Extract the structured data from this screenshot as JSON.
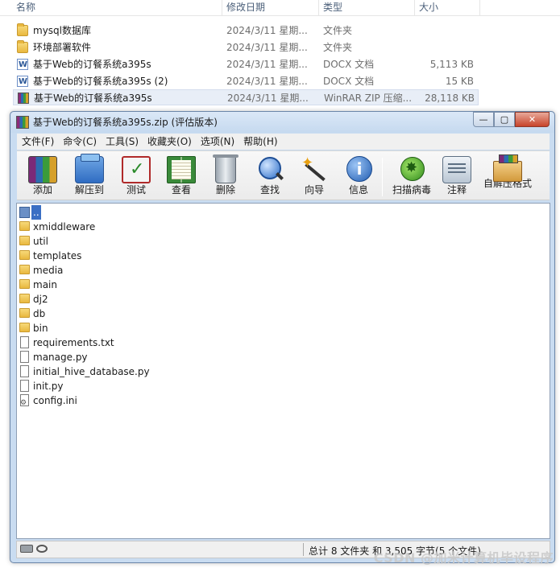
{
  "explorer": {
    "columns": {
      "name": "名称",
      "date": "修改日期",
      "type": "类型",
      "size": "大小"
    },
    "rows": [
      {
        "name": "mysql数据库",
        "date": "2024/3/11 星期...",
        "type": "文件夹",
        "size": "",
        "icon": "folder-icon"
      },
      {
        "name": "环境部署软件",
        "date": "2024/3/11 星期...",
        "type": "文件夹",
        "size": "",
        "icon": "folder-icon"
      },
      {
        "name": "基于Web的订餐系统a395s",
        "date": "2024/3/11 星期...",
        "type": "DOCX 文档",
        "size": "5,113 KB",
        "icon": "docx-icon"
      },
      {
        "name": "基于Web的订餐系统a395s (2)",
        "date": "2024/3/11 星期...",
        "type": "DOCX 文档",
        "size": "15 KB",
        "icon": "docx-icon"
      },
      {
        "name": "基于Web的订餐系统a395s",
        "date": "2024/3/11 星期...",
        "type": "WinRAR ZIP 压缩...",
        "size": "28,118 KB",
        "icon": "winrar-archive-icon"
      }
    ]
  },
  "window": {
    "title": "基于Web的订餐系统a395s.zip (评估版本)",
    "buttons": {
      "minimize": "—",
      "maximize": "▢",
      "close": "✕"
    }
  },
  "menu": [
    {
      "label": "文件(F)"
    },
    {
      "label": "命令(C)"
    },
    {
      "label": "工具(S)"
    },
    {
      "label": "收藏夹(O)"
    },
    {
      "label": "选项(N)"
    },
    {
      "label": "帮助(H)"
    }
  ],
  "toolbar": [
    {
      "label": "添加",
      "icon": "add-archive-icon"
    },
    {
      "label": "解压到",
      "icon": "extract-icon"
    },
    {
      "label": "测试",
      "icon": "test-icon"
    },
    {
      "label": "查看",
      "icon": "view-book-icon"
    },
    {
      "label": "删除",
      "icon": "trash-icon"
    },
    {
      "label": "查找",
      "icon": "magnifier-icon"
    },
    {
      "label": "向导",
      "icon": "wizard-wand-icon"
    },
    {
      "label": "信息",
      "icon": "info-icon"
    },
    {
      "label": "扫描病毒",
      "icon": "virus-scan-icon"
    },
    {
      "label": "注释",
      "icon": "comment-icon"
    },
    {
      "label": "自解压格式",
      "icon": "sfx-box-icon"
    }
  ],
  "files": [
    {
      "name": "..",
      "kind": "up"
    },
    {
      "name": "xmiddleware",
      "kind": "folder"
    },
    {
      "name": "util",
      "kind": "folder"
    },
    {
      "name": "templates",
      "kind": "folder"
    },
    {
      "name": "media",
      "kind": "folder"
    },
    {
      "name": "main",
      "kind": "folder"
    },
    {
      "name": "dj2",
      "kind": "folder"
    },
    {
      "name": "db",
      "kind": "folder"
    },
    {
      "name": "bin",
      "kind": "folder"
    },
    {
      "name": "requirements.txt",
      "kind": "file"
    },
    {
      "name": "manage.py",
      "kind": "file"
    },
    {
      "name": "initial_hive_database.py",
      "kind": "file"
    },
    {
      "name": "init.py",
      "kind": "file"
    },
    {
      "name": "config.ini",
      "kind": "config"
    }
  ],
  "status": {
    "summary": "总计 8 文件夹 和 3,505 字节(5 个文件)",
    "watermark": "CSDN @加米计算机毕设程序"
  }
}
